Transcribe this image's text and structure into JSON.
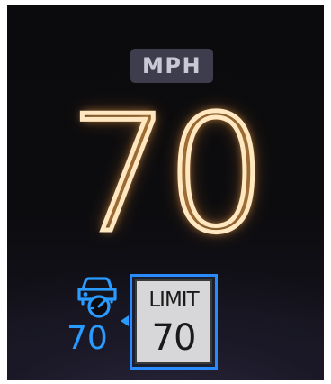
{
  "unit_label": "MPH",
  "current_speed": "70",
  "cruise_control": {
    "icon": "adaptive-cruise-control-icon",
    "set_speed": "70",
    "color": "#2a9bff"
  },
  "speed_limit_sign": {
    "label": "LIMIT",
    "value": "70"
  },
  "colors": {
    "speed_glow": "#ffb050",
    "speed_core": "#ffe7c2",
    "badge_bg": "#3d3d4d",
    "badge_text": "#c9c9d6",
    "accent_blue": "#2a9bff"
  }
}
